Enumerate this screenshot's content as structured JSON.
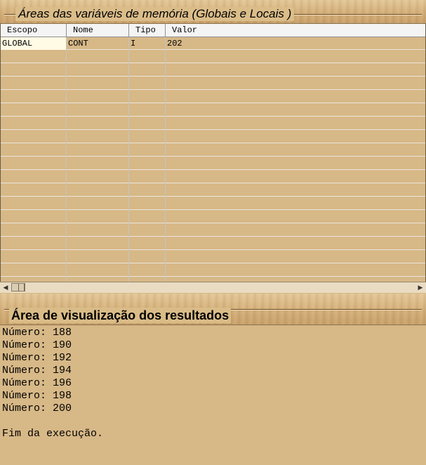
{
  "variables_panel": {
    "title": "Áreas das variáveis de memória (Globais e Locais )",
    "columns": [
      "Escopo",
      "Nome",
      "Tipo",
      "Valor"
    ],
    "rows": [
      {
        "escopo": "GLOBAL",
        "nome": "CONT",
        "tipo": "I",
        "valor": "202"
      }
    ]
  },
  "results_panel": {
    "title": "Área de visualização dos resultados",
    "lines": [
      "Número: 188",
      "Número: 190",
      "Número: 192",
      "Número: 194",
      "Número: 196",
      "Número: 198",
      "Número: 200",
      "",
      "Fim da execução."
    ]
  },
  "icons": {
    "scroll_left": "triangle-left-icon",
    "scroll_right": "triangle-right-icon",
    "scroll_thumb": "grip-icon"
  },
  "colors": {
    "background": "#d7b887",
    "selected_cell": "#fffbe4",
    "header_bg": "#f4f4f4"
  }
}
